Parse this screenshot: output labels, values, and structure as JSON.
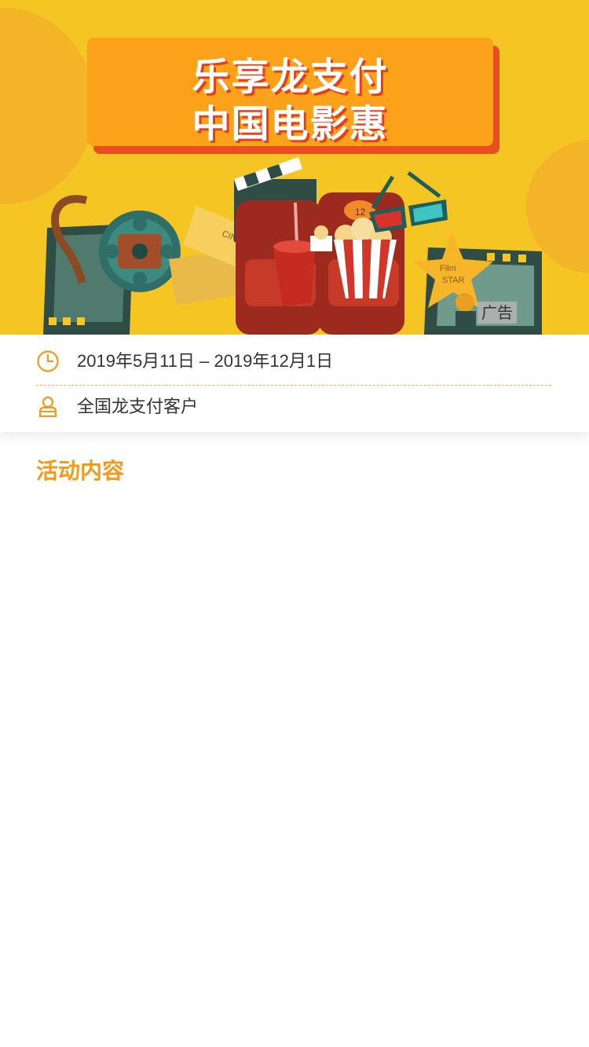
{
  "banner": {
    "title_line1": "乐享龙支付",
    "title_line2": "中国电影惠",
    "ad_label": "广告",
    "ticket_text": "CINEMA TICKET",
    "seat_number": "12",
    "star_text1": "Film",
    "star_text2": "STAR"
  },
  "info": {
    "date_range": "2019年5月11日 – 2019年12月1日",
    "audience": "全国龙支付客户"
  },
  "content": {
    "section_title": "活动内容"
  },
  "colors": {
    "accent": "#f39a1d",
    "banner_bg": "#f5c523",
    "title_box": "#fca21a",
    "title_shadow": "#e84e1f"
  }
}
